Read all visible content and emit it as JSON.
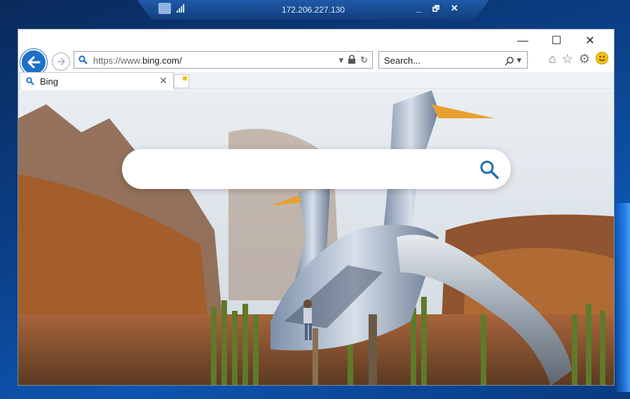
{
  "remote_bar": {
    "title": "172.206.227.130",
    "minimize": "_",
    "restore": "🗗",
    "close": "✕"
  },
  "window": {
    "minimize": "—",
    "maximize": "☐",
    "close": "✕"
  },
  "nav": {
    "back": "🡐",
    "forward": "⇨",
    "address": {
      "scheme": "https://",
      "host_prefix": "www.",
      "host": "bing.com/"
    },
    "address_dropdown": "▾",
    "lock": "🔒",
    "refresh": "↻",
    "search_placeholder": "Search...",
    "search_icon": "⌕",
    "search_dropdown": "▾"
  },
  "toolbar": {
    "home": "⌂",
    "favorites": "☆",
    "settings": "⚙"
  },
  "tabs": [
    {
      "label": "Bing",
      "close": "✕"
    }
  ],
  "bing": {
    "search_placeholder": ""
  },
  "colors": {
    "accent": "#1d6fc8",
    "bing_search_icon": "#1f6fb5"
  }
}
